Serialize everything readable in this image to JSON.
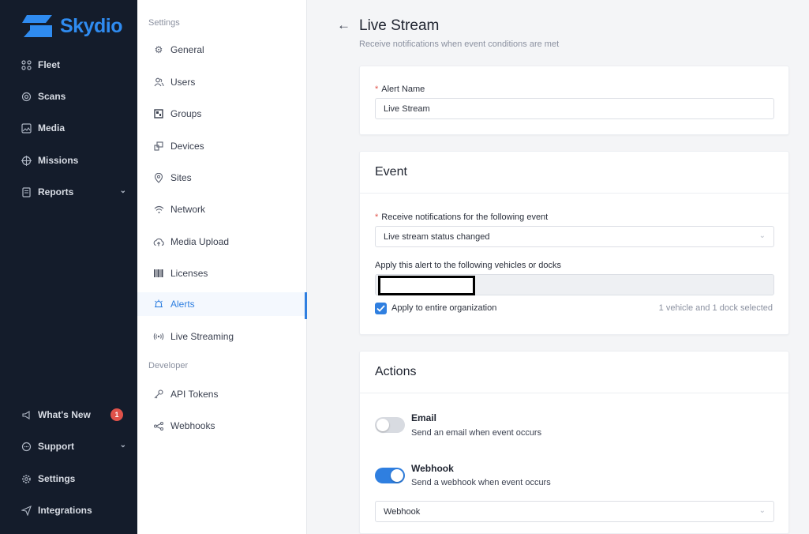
{
  "brand": {
    "name": "Skydio",
    "color": "#2f8bf0"
  },
  "left_nav": {
    "items": [
      {
        "label": "Fleet",
        "icon": "fleet-icon"
      },
      {
        "label": "Scans",
        "icon": "scans-icon"
      },
      {
        "label": "Media",
        "icon": "media-icon"
      },
      {
        "label": "Missions",
        "icon": "missions-icon"
      },
      {
        "label": "Reports",
        "icon": "reports-icon",
        "has_chevron": true
      }
    ],
    "bottom_items": [
      {
        "label": "What's New",
        "icon": "megaphone-icon",
        "badge": "1"
      },
      {
        "label": "Support",
        "icon": "support-icon",
        "has_chevron": true
      },
      {
        "label": "Settings",
        "icon": "gear-icon"
      },
      {
        "label": "Integrations",
        "icon": "integrations-icon"
      }
    ]
  },
  "settings_nav": {
    "heading": "Settings",
    "items": [
      {
        "label": "General",
        "icon": "gear-icon"
      },
      {
        "label": "Users",
        "icon": "users-icon"
      },
      {
        "label": "Groups",
        "icon": "groups-icon"
      },
      {
        "label": "Devices",
        "icon": "devices-icon"
      },
      {
        "label": "Sites",
        "icon": "location-pin-icon"
      },
      {
        "label": "Network",
        "icon": "wifi-icon"
      },
      {
        "label": "Media Upload",
        "icon": "cloud-upload-icon"
      },
      {
        "label": "Licenses",
        "icon": "barcode-icon"
      },
      {
        "label": "Alerts",
        "icon": "bell-icon",
        "active": true
      },
      {
        "label": "Live Streaming",
        "icon": "broadcast-icon"
      }
    ],
    "developer_heading": "Developer",
    "developer_items": [
      {
        "label": "API Tokens",
        "icon": "key-icon"
      },
      {
        "label": "Webhooks",
        "icon": "webhook-icon"
      }
    ]
  },
  "page": {
    "title": "Live Stream",
    "subtitle": "Receive notifications when event conditions are met"
  },
  "alert_name": {
    "required_mark": "*",
    "label": "Alert Name",
    "value": "Live Stream"
  },
  "event": {
    "heading": "Event",
    "trigger_label": "Receive notifications for the following event",
    "trigger_value": "Live stream status changed",
    "vehicles_label": "Apply this alert to the following vehicles or docks",
    "apply_org_label": "Apply to entire organization",
    "apply_org_checked": true,
    "selection_summary": "1 vehicle and 1 dock selected"
  },
  "actions": {
    "heading": "Actions",
    "email": {
      "title": "Email",
      "desc": "Send an email when event occurs",
      "enabled": false
    },
    "webhook": {
      "title": "Webhook",
      "desc": "Send a webhook when event occurs",
      "enabled": true,
      "select_value": "Webhook"
    }
  },
  "colors": {
    "accent": "#2f7fe0",
    "nav_bg": "#141c2b",
    "badge": "#e0524a"
  }
}
